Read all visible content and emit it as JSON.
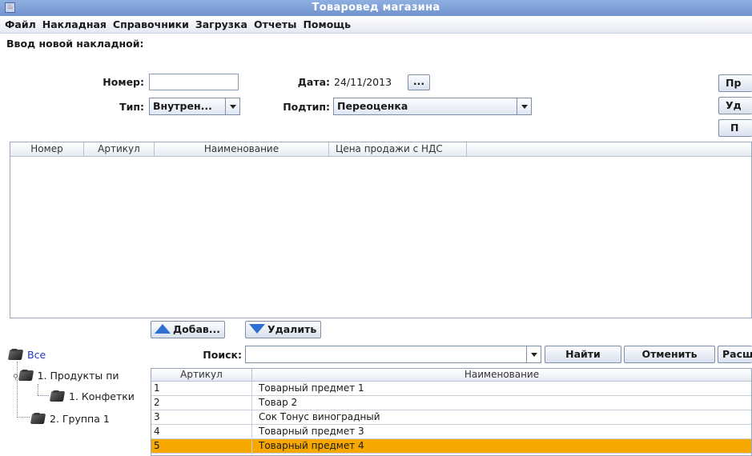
{
  "window": {
    "title": "Товаровед магазина"
  },
  "menu": {
    "items": [
      "Файл",
      "Накладная",
      "Справочники",
      "Загрузка",
      "Отчеты",
      "Помощь"
    ]
  },
  "form": {
    "section_title": "Ввод новой накладной:",
    "number_label": "Номер:",
    "number_value": "",
    "date_label": "Дата:",
    "date_value": "24/11/2013",
    "date_button": "...",
    "type_label": "Тип:",
    "type_value": "Внутрен...",
    "subtype_label": "Подтип:",
    "subtype_value": "Переоценка"
  },
  "side_buttons": [
    "Пр",
    "Уд",
    "П"
  ],
  "invoice_table": {
    "columns": [
      "Номер",
      "Артикул",
      "Наименование",
      "Цена продажи с НДС"
    ]
  },
  "toolbar": {
    "add_label": "Добав...",
    "delete_label": "Удалить"
  },
  "tree": {
    "root": "Все",
    "nodes": [
      "1. Продукты пи",
      "1. Конфетки",
      "2. Группа 1"
    ]
  },
  "search": {
    "label": "Поиск:",
    "value": "",
    "find_button": "Найти",
    "cancel_button": "Отменить",
    "extra_button": "Расш"
  },
  "products_table": {
    "columns": [
      "Артикул",
      "Наименование"
    ],
    "rows": [
      {
        "article": "1",
        "name": "Товарный предмет 1"
      },
      {
        "article": "2",
        "name": "Товар 2"
      },
      {
        "article": "3",
        "name": "Сок Тонус виноградный"
      },
      {
        "article": "4",
        "name": "Товарный предмет 3"
      },
      {
        "article": "5",
        "name": "Товарный предмет 4"
      }
    ],
    "selected_index": 4
  },
  "colors": {
    "selection": "#f7a800",
    "titlebar": "#7a9bd6",
    "icon_blue": "#2f6fd0"
  }
}
